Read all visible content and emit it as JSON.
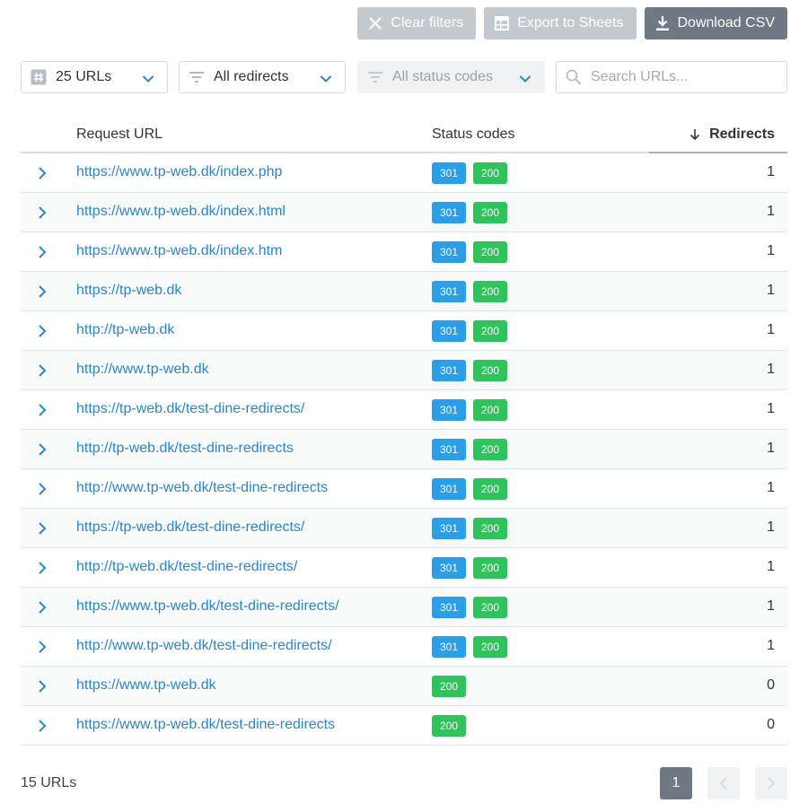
{
  "toolbar": {
    "clear_filters": "Clear filters",
    "export_sheets": "Export to Sheets",
    "download_csv": "Download CSV"
  },
  "filters": {
    "urls_select": "25 URLs",
    "redirects_select": "All redirects",
    "status_select": "All status codes",
    "search_placeholder": "Search URLs..."
  },
  "table": {
    "headers": {
      "request_url": "Request URL",
      "status_codes": "Status codes",
      "redirects": "Redirects"
    },
    "sort": "descending",
    "rows": [
      {
        "url": "https://www.tp-web.dk/index.php",
        "codes": [
          "301",
          "200"
        ],
        "redirects": "1"
      },
      {
        "url": "https://www.tp-web.dk/index.html",
        "codes": [
          "301",
          "200"
        ],
        "redirects": "1"
      },
      {
        "url": "https://www.tp-web.dk/index.htm",
        "codes": [
          "301",
          "200"
        ],
        "redirects": "1"
      },
      {
        "url": "https://tp-web.dk",
        "codes": [
          "301",
          "200"
        ],
        "redirects": "1"
      },
      {
        "url": "http://tp-web.dk",
        "codes": [
          "301",
          "200"
        ],
        "redirects": "1"
      },
      {
        "url": "http://www.tp-web.dk",
        "codes": [
          "301",
          "200"
        ],
        "redirects": "1"
      },
      {
        "url": "https://tp-web.dk/test-dine-redirects/",
        "codes": [
          "301",
          "200"
        ],
        "redirects": "1"
      },
      {
        "url": "http://tp-web.dk/test-dine-redirects",
        "codes": [
          "301",
          "200"
        ],
        "redirects": "1"
      },
      {
        "url": "http://www.tp-web.dk/test-dine-redirects",
        "codes": [
          "301",
          "200"
        ],
        "redirects": "1"
      },
      {
        "url": "https://tp-web.dk/test-dine-redirects/",
        "codes": [
          "301",
          "200"
        ],
        "redirects": "1"
      },
      {
        "url": "http://tp-web.dk/test-dine-redirects/",
        "codes": [
          "301",
          "200"
        ],
        "redirects": "1"
      },
      {
        "url": "https://www.tp-web.dk/test-dine-redirects/",
        "codes": [
          "301",
          "200"
        ],
        "redirects": "1"
      },
      {
        "url": "http://www.tp-web.dk/test-dine-redirects/",
        "codes": [
          "301",
          "200"
        ],
        "redirects": "1"
      },
      {
        "url": "https://www.tp-web.dk",
        "codes": [
          "200"
        ],
        "redirects": "0"
      },
      {
        "url": "https://www.tp-web.dk/test-dine-redirects",
        "codes": [
          "200"
        ],
        "redirects": "0"
      }
    ]
  },
  "footer": {
    "count": "15 URLs",
    "current_page": "1"
  },
  "colors": {
    "link": "#2a86c7",
    "badge_301": "#2a9ee6",
    "badge_200": "#2fc35c",
    "primary_button": "#6e7985",
    "disabled_button": "#c4c9cf"
  },
  "icons": {
    "clear_filters": "close-icon",
    "export_sheets": "sheets-icon",
    "download_csv": "download-icon",
    "urls_select": "hash-icon",
    "redirects_select": "filter-icon",
    "status_select": "filter-icon",
    "search": "search-icon",
    "sort": "arrow-down-icon",
    "row_expand": "chevron-right-icon"
  }
}
